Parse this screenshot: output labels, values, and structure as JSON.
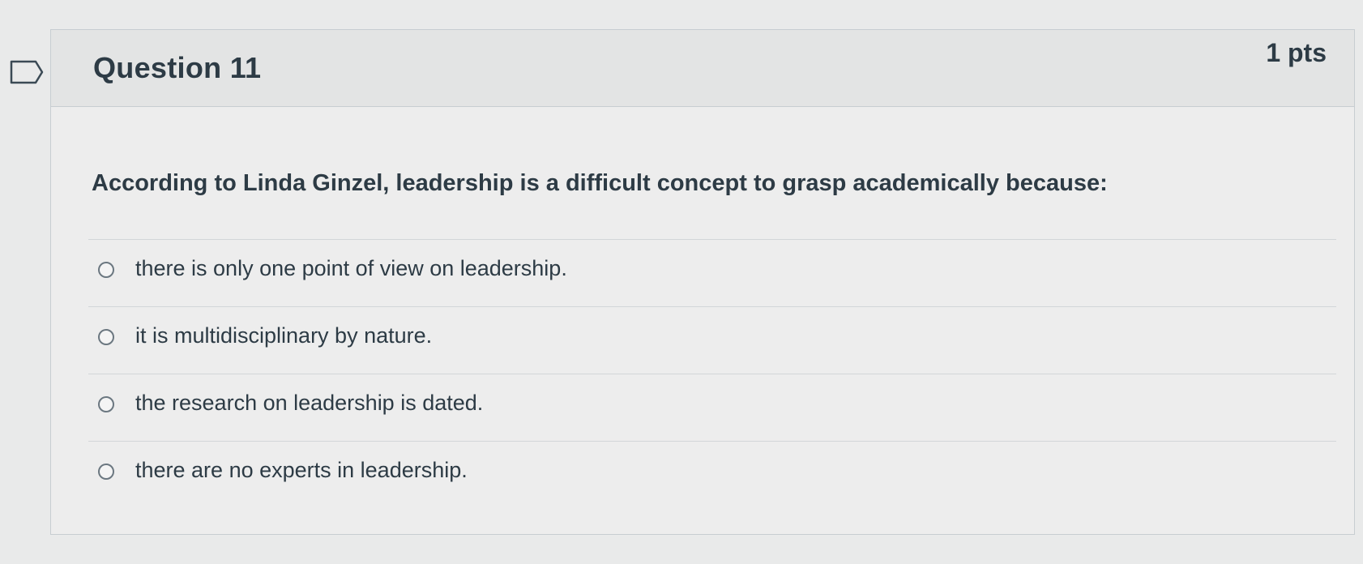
{
  "question": {
    "title": "Question 11",
    "points": "1 pts",
    "text": "According to Linda Ginzel, leadership is a difficult concept to grasp academically because:",
    "answers": [
      {
        "label": "there is only one point of view on leadership."
      },
      {
        "label": "it is multidisciplinary by nature."
      },
      {
        "label": "the research on leadership is dated."
      },
      {
        "label": "there are no experts in leadership."
      }
    ]
  },
  "icons": {
    "flag": "flag-question-icon",
    "radio": "radio-button-icon"
  },
  "colors": {
    "text": "#2d3b45",
    "header_bg": "#e3e4e4",
    "border": "#c7cdd1"
  }
}
